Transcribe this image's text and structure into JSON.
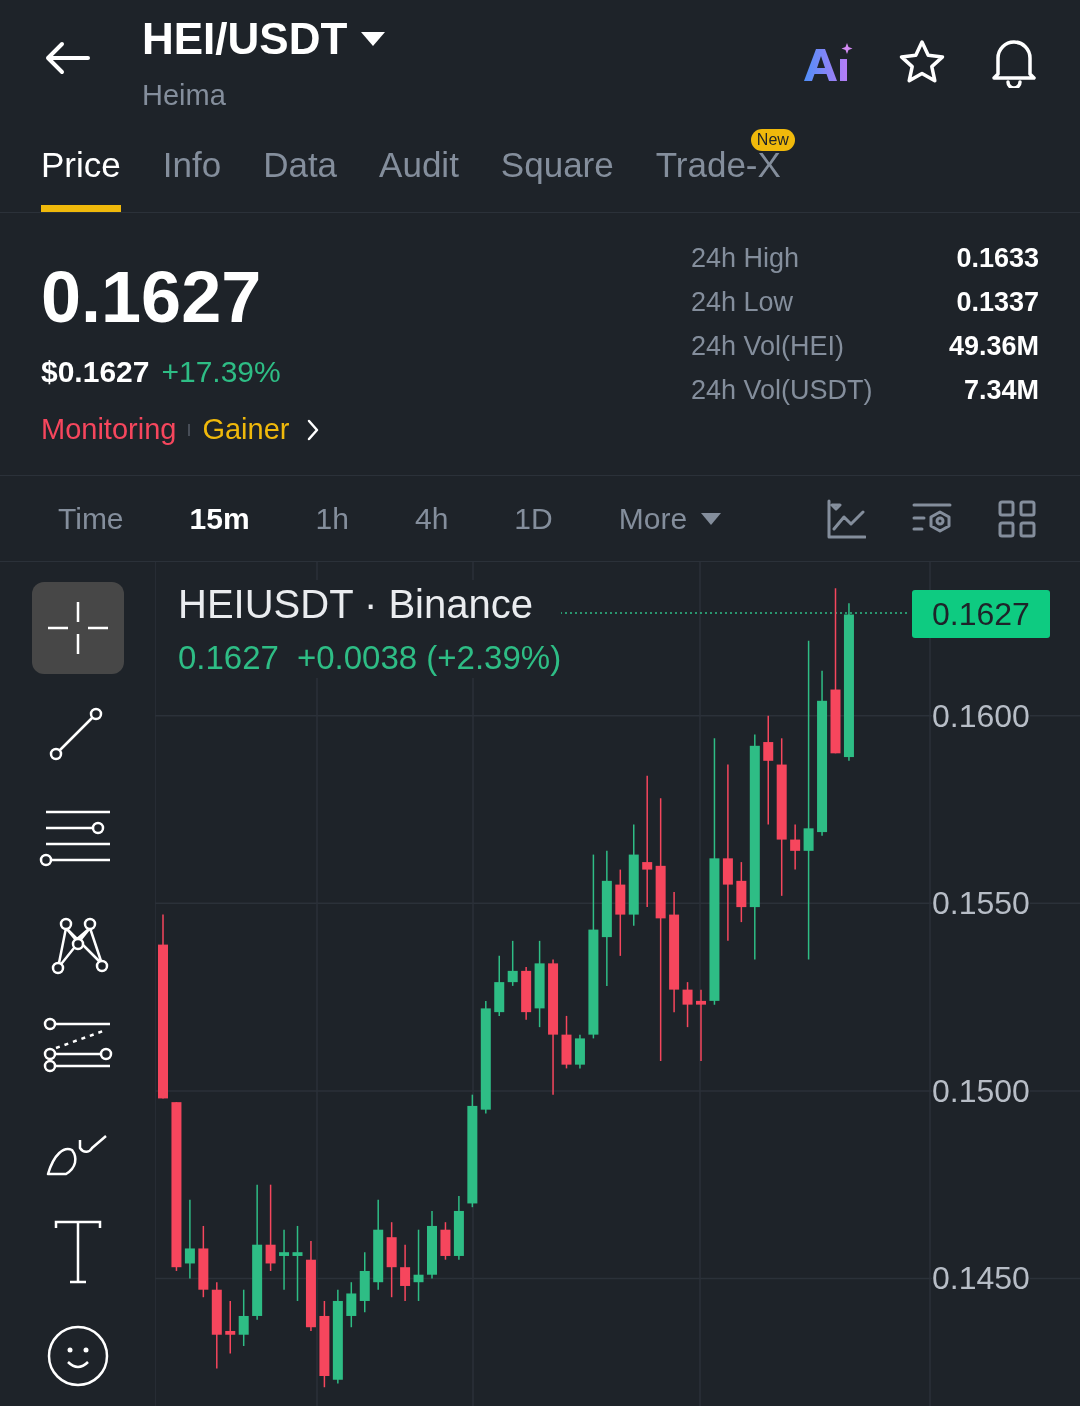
{
  "header": {
    "title": "HEI/USDT",
    "subtitle": "Heima"
  },
  "tabs": [
    {
      "label": "Price",
      "selected": true
    },
    {
      "label": "Info",
      "selected": false
    },
    {
      "label": "Data",
      "selected": false
    },
    {
      "label": "Audit",
      "selected": false
    },
    {
      "label": "Square",
      "selected": false
    },
    {
      "label": "Trade-X",
      "selected": false,
      "badge": "New"
    }
  ],
  "price": {
    "last": "0.1627",
    "usd": "$0.1627",
    "change": "+17.39%",
    "tags": [
      {
        "text": "Monitoring",
        "kind": "alert"
      },
      {
        "text": "Gainer",
        "kind": "category"
      }
    ]
  },
  "stats": [
    {
      "label": "24h High",
      "value": "0.1633"
    },
    {
      "label": "24h Low",
      "value": "0.1337"
    },
    {
      "label": "24h Vol(HEI)",
      "value": "49.36M"
    },
    {
      "label": "24h Vol(USDT)",
      "value": "7.34M"
    }
  ],
  "intervals": [
    {
      "label": "Time",
      "selected": false
    },
    {
      "label": "15m",
      "selected": true
    },
    {
      "label": "1h",
      "selected": false
    },
    {
      "label": "4h",
      "selected": false
    },
    {
      "label": "1D",
      "selected": false
    }
  ],
  "more": "More",
  "tools": [
    {
      "kind": "crosshair",
      "selected": true
    },
    {
      "kind": "trend-line",
      "selected": false
    },
    {
      "kind": "parallel-lines",
      "selected": false
    },
    {
      "kind": "pattern",
      "selected": false
    },
    {
      "kind": "fib",
      "selected": false
    },
    {
      "kind": "brush",
      "selected": false
    },
    {
      "kind": "text",
      "selected": false
    },
    {
      "kind": "emoji",
      "selected": false
    }
  ],
  "chart": {
    "symbol": "HEIUSDT · Binance",
    "close": "0.1627",
    "change": "+0.0038 (+2.39%)",
    "current_price": "0.1627",
    "chart_data": {
      "type": "candlestick",
      "grid": true,
      "ylim": [
        0.1416,
        0.1641
      ],
      "ohlc": [
        [
          0.1539,
          0.1547,
          0.1498,
          0.1498
        ],
        [
          0.1497,
          0.1497,
          0.1452,
          0.1453
        ],
        [
          0.1454,
          0.1471,
          0.145,
          0.1458
        ],
        [
          0.1458,
          0.1464,
          0.1445,
          0.1447
        ],
        [
          0.1447,
          0.1449,
          0.1426,
          0.1435
        ],
        [
          0.1436,
          0.1444,
          0.143,
          0.1435
        ],
        [
          0.1435,
          0.1447,
          0.1432,
          0.144
        ],
        [
          0.144,
          0.1475,
          0.1439,
          0.1459
        ],
        [
          0.1459,
          0.1475,
          0.1452,
          0.1454
        ],
        [
          0.1456,
          0.1463,
          0.1447,
          0.1457
        ],
        [
          0.1456,
          0.1464,
          0.1444,
          0.1457
        ],
        [
          0.1455,
          0.146,
          0.1436,
          0.1437
        ],
        [
          0.144,
          0.1444,
          0.1421,
          0.1424
        ],
        [
          0.1423,
          0.1447,
          0.1422,
          0.1444
        ],
        [
          0.144,
          0.1449,
          0.1437,
          0.1446
        ],
        [
          0.1444,
          0.1457,
          0.1441,
          0.1452
        ],
        [
          0.1449,
          0.1471,
          0.1447,
          0.1463
        ],
        [
          0.1461,
          0.1465,
          0.1445,
          0.1453
        ],
        [
          0.1453,
          0.1459,
          0.1444,
          0.1448
        ],
        [
          0.1449,
          0.1463,
          0.1444,
          0.1451
        ],
        [
          0.1451,
          0.1468,
          0.145,
          0.1464
        ],
        [
          0.1463,
          0.1465,
          0.1455,
          0.1456
        ],
        [
          0.1456,
          0.1472,
          0.1455,
          0.1468
        ],
        [
          0.147,
          0.1499,
          0.1469,
          0.1496
        ],
        [
          0.1495,
          0.1524,
          0.1494,
          0.1522
        ],
        [
          0.1521,
          0.1536,
          0.152,
          0.1529
        ],
        [
          0.1529,
          0.154,
          0.1528,
          0.1532
        ],
        [
          0.1532,
          0.1533,
          0.1519,
          0.1521
        ],
        [
          0.1522,
          0.154,
          0.1517,
          0.1534
        ],
        [
          0.1534,
          0.1535,
          0.1499,
          0.1515
        ],
        [
          0.1515,
          0.152,
          0.1506,
          0.1507
        ],
        [
          0.1507,
          0.1515,
          0.1506,
          0.1514
        ],
        [
          0.1515,
          0.1563,
          0.1514,
          0.1543
        ],
        [
          0.1541,
          0.1564,
          0.1528,
          0.1556
        ],
        [
          0.1555,
          0.1559,
          0.1536,
          0.1547
        ],
        [
          0.1547,
          0.1571,
          0.1544,
          0.1563
        ],
        [
          0.1561,
          0.1584,
          0.1549,
          0.1559
        ],
        [
          0.156,
          0.1578,
          0.1508,
          0.1546
        ],
        [
          0.1547,
          0.1553,
          0.1521,
          0.1527
        ],
        [
          0.1527,
          0.1529,
          0.1517,
          0.1523
        ],
        [
          0.1524,
          0.1527,
          0.1508,
          0.1523
        ],
        [
          0.1524,
          0.1594,
          0.1523,
          0.1562
        ],
        [
          0.1562,
          0.1587,
          0.154,
          0.1555
        ],
        [
          0.1556,
          0.1561,
          0.1545,
          0.1549
        ],
        [
          0.1549,
          0.1595,
          0.1535,
          0.1592
        ],
        [
          0.1593,
          0.16,
          0.1571,
          0.1588
        ],
        [
          0.1587,
          0.1594,
          0.1552,
          0.1567
        ],
        [
          0.1567,
          0.1571,
          0.1559,
          0.1564
        ],
        [
          0.1564,
          0.162,
          0.1535,
          0.157
        ],
        [
          0.1569,
          0.1612,
          0.1568,
          0.1604
        ],
        [
          0.1607,
          0.1634,
          0.159,
          0.159
        ],
        [
          0.1589,
          0.163,
          0.1588,
          0.1627
        ]
      ],
      "yticks": [
        {
          "value": 0.16,
          "label": "0.1600"
        },
        {
          "value": 0.155,
          "label": "0.1550"
        },
        {
          "value": 0.15,
          "label": "0.1500"
        },
        {
          "value": 0.145,
          "label": "0.1450"
        }
      ]
    }
  }
}
